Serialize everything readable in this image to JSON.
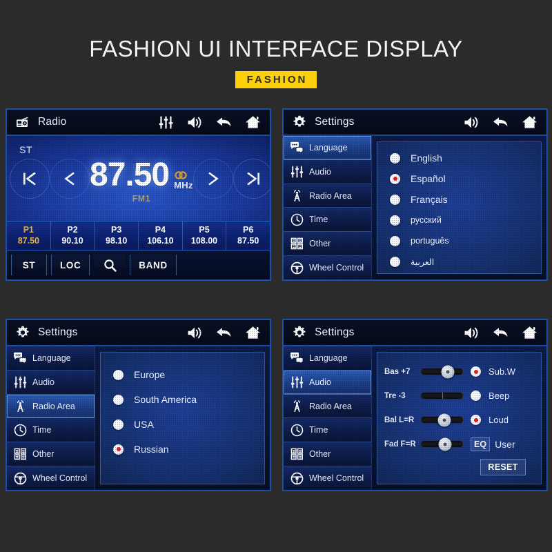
{
  "header": {
    "title": "FASHION UI INTERFACE DISPLAY",
    "badge": "FASHION",
    "badge_color": "#fcd10b"
  },
  "colors": {
    "accent_blue": "#1c4fa8",
    "screen_blue": "#1b3a9e",
    "selected_red": "#e01f1f",
    "preset_active": "#e8b344",
    "band_gold": "#b8a063"
  },
  "radio_panel": {
    "titlebar": {
      "icon": "radio-icon",
      "title": "Radio",
      "actions": [
        "equalizer-icon",
        "volume-icon",
        "back-icon",
        "home-icon"
      ]
    },
    "stereo_indicator": "ST",
    "frequency": "87.50",
    "unit": "MHz",
    "stereo_icon": "stereo-dual-circle-icon",
    "band": "FM1",
    "nav_buttons": [
      {
        "name": "seek-prev",
        "glyph": "|<"
      },
      {
        "name": "tune-down",
        "glyph": "<"
      },
      {
        "name": "tune-up",
        "glyph": ">"
      },
      {
        "name": "seek-next",
        "glyph": ">|"
      }
    ],
    "presets": [
      {
        "name": "P1",
        "value": "87.50",
        "active": true
      },
      {
        "name": "P2",
        "value": "90.10",
        "active": false
      },
      {
        "name": "P3",
        "value": "98.10",
        "active": false
      },
      {
        "name": "P4",
        "value": "106.10",
        "active": false
      },
      {
        "name": "P5",
        "value": "108.00",
        "active": false
      },
      {
        "name": "P6",
        "value": "87.50",
        "active": false
      }
    ],
    "bottom_buttons": [
      {
        "name": "st-button",
        "label": "ST"
      },
      {
        "name": "loc-button",
        "label": "LOC"
      },
      {
        "name": "search-button",
        "label": "",
        "icon": "search-icon"
      },
      {
        "name": "band-button",
        "label": "BAND"
      }
    ]
  },
  "settings": {
    "titlebar": {
      "icon": "gear-icon",
      "title": "Settings",
      "actions": [
        "volume-icon",
        "back-icon",
        "home-icon"
      ]
    },
    "sidebar": [
      {
        "label": "Language",
        "icon": "speech-bubble-icon"
      },
      {
        "label": "Audio",
        "icon": "sliders-icon"
      },
      {
        "label": "Radio Area",
        "icon": "antenna-tower-icon"
      },
      {
        "label": "Time",
        "icon": "clock-icon"
      },
      {
        "label": "Other",
        "icon": "grid-icon"
      },
      {
        "label": "Wheel Control",
        "icon": "steering-wheel-icon"
      }
    ]
  },
  "language_panel": {
    "active_sidebar_index": 0,
    "options": [
      {
        "label": "English",
        "selected": false
      },
      {
        "label": "Español",
        "selected": true
      },
      {
        "label": "Français",
        "selected": false
      },
      {
        "label": "русский",
        "selected": false
      },
      {
        "label": "português",
        "selected": false
      },
      {
        "label": "العربية",
        "selected": false
      }
    ]
  },
  "radio_area_panel": {
    "active_sidebar_index": 2,
    "options": [
      {
        "label": "Europe",
        "selected": false
      },
      {
        "label": "South America",
        "selected": false
      },
      {
        "label": "USA",
        "selected": false
      },
      {
        "label": "Russian",
        "selected": true
      }
    ]
  },
  "audio_panel": {
    "active_sidebar_index": 1,
    "sliders": [
      {
        "label": "Bas +7",
        "name": "bass-slider",
        "position": 63,
        "has_thumb": true
      },
      {
        "label": "Tre -3",
        "name": "treble-slider",
        "position": 50,
        "has_thumb": false
      },
      {
        "label": "Bal L=R",
        "name": "balance-slider",
        "position": 55,
        "has_thumb": true
      },
      {
        "label": "Fad F=R",
        "name": "fader-slider",
        "position": 57,
        "has_thumb": true
      }
    ],
    "toggles": [
      {
        "label": "Sub.W",
        "selected": true
      },
      {
        "label": "Beep",
        "selected": false
      },
      {
        "label": "Loud",
        "selected": true
      }
    ],
    "eq": {
      "tag": "EQ",
      "value": "User"
    },
    "reset_label": "RESET"
  }
}
